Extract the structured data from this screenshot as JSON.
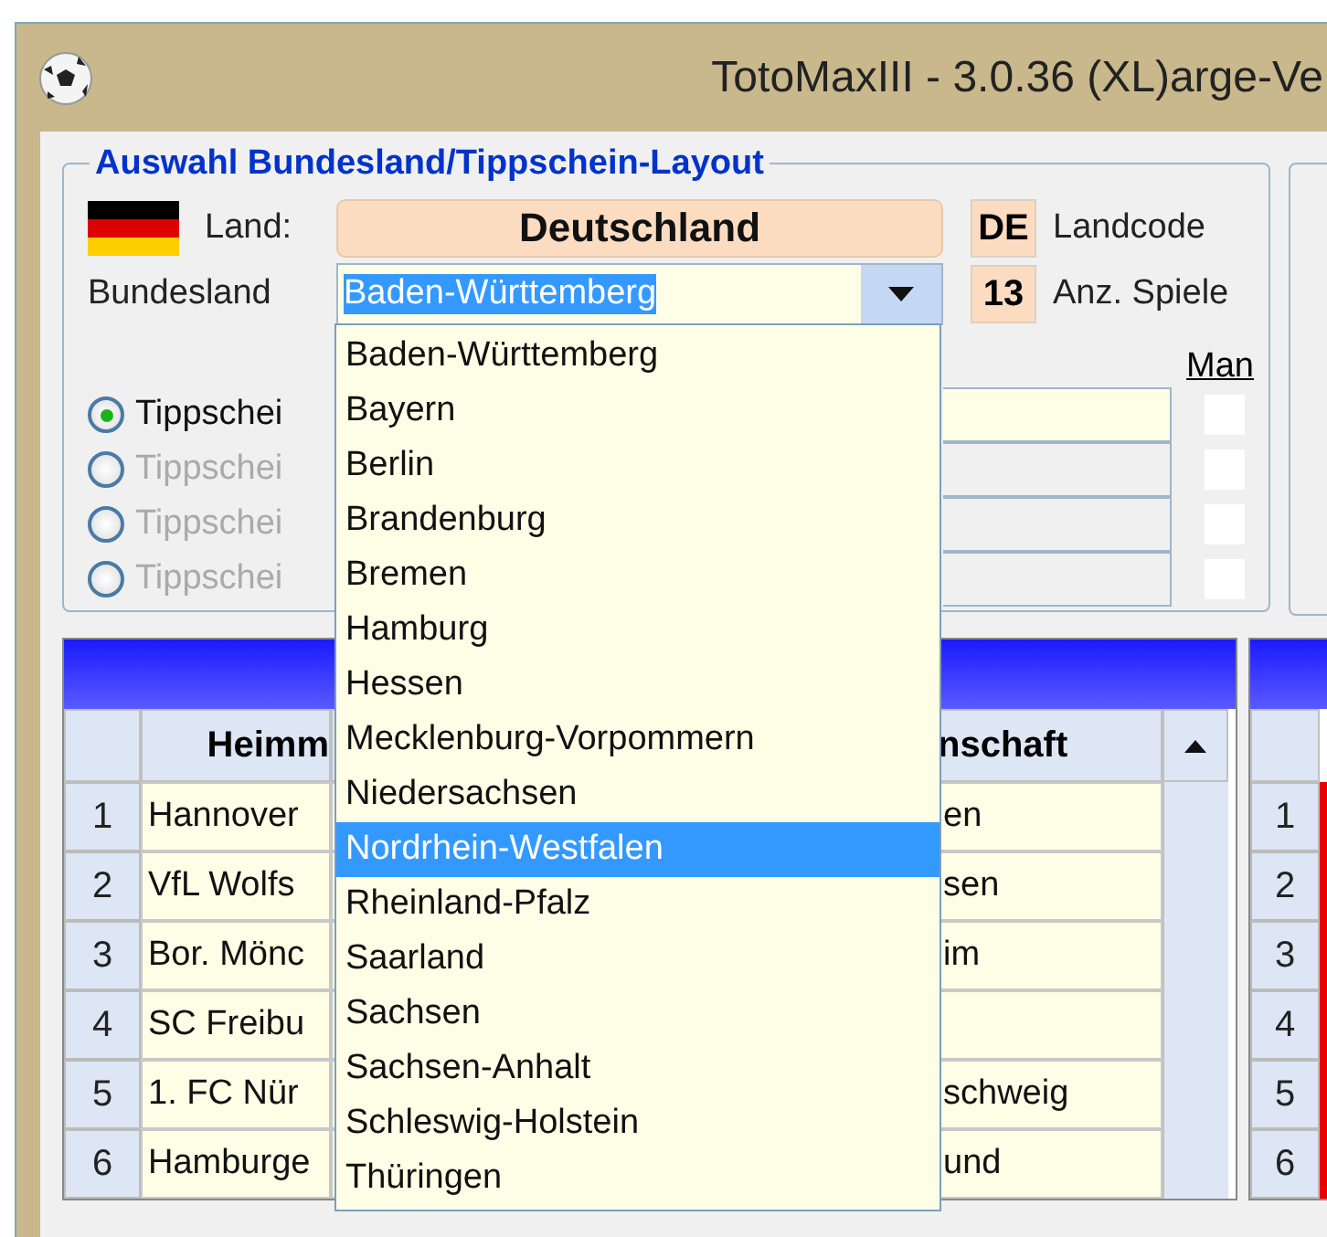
{
  "window": {
    "title": "TotoMaxIII - 3.0.36 (XL)arge-Ve"
  },
  "selection_group": {
    "title": "Auswahl Bundesland/Tippschein-Layout",
    "land_label": "Land:",
    "land_value": "Deutschland",
    "bundesland_label": "Bundesland",
    "bundesland_value": "Baden-Württemberg",
    "landcode": "DE",
    "landcode_label": "Landcode",
    "games": "13",
    "games_label": "Anz. Spiele",
    "man_label": "Man",
    "layouts": [
      {
        "label": "Tippschei",
        "selected": true,
        "disabled": false,
        "checked": false
      },
      {
        "label": "Tippschei",
        "selected": false,
        "disabled": true,
        "checked": false
      },
      {
        "label": "Tippschei",
        "selected": false,
        "disabled": true,
        "checked": false
      },
      {
        "label": "Tippschei",
        "selected": false,
        "disabled": true,
        "checked": false
      }
    ]
  },
  "bundesland_dropdown": {
    "items": [
      {
        "label": "Baden-Württemberg",
        "selected": false
      },
      {
        "label": "Bayern",
        "selected": false
      },
      {
        "label": "Berlin",
        "selected": false
      },
      {
        "label": "Brandenburg",
        "selected": false
      },
      {
        "label": "Bremen",
        "selected": false
      },
      {
        "label": "Hamburg",
        "selected": false
      },
      {
        "label": "Hessen",
        "selected": false
      },
      {
        "label": "Mecklenburg-Vorpommern",
        "selected": false
      },
      {
        "label": "Niedersachsen",
        "selected": false
      },
      {
        "label": "Nordrhein-Westfalen",
        "selected": true
      },
      {
        "label": "Rheinland-Pfalz",
        "selected": false
      },
      {
        "label": "Saarland",
        "selected": false
      },
      {
        "label": "Sachsen",
        "selected": false
      },
      {
        "label": "Sachsen-Anhalt",
        "selected": false
      },
      {
        "label": "Schleswig-Holstein",
        "selected": false
      },
      {
        "label": "Thüringen",
        "selected": false
      }
    ]
  },
  "games_table": {
    "columns": [
      "Heimm",
      "nschaft"
    ],
    "rows": [
      {
        "number": "1",
        "home": "Hannover",
        "away": "en"
      },
      {
        "number": "2",
        "home": "VfL Wolfs",
        "away": "sen"
      },
      {
        "number": "3",
        "home": "Bor. Mönc",
        "away": "im"
      },
      {
        "number": "4",
        "home": "SC Freibu",
        "away": ""
      },
      {
        "number": "5",
        "home": "1. FC Nür",
        "away": "schweig"
      },
      {
        "number": "6",
        "home": "Hamburge",
        "away": "und"
      }
    ]
  },
  "second_table": {
    "rows": [
      "1",
      "2",
      "3",
      "4",
      "5",
      "6"
    ]
  }
}
